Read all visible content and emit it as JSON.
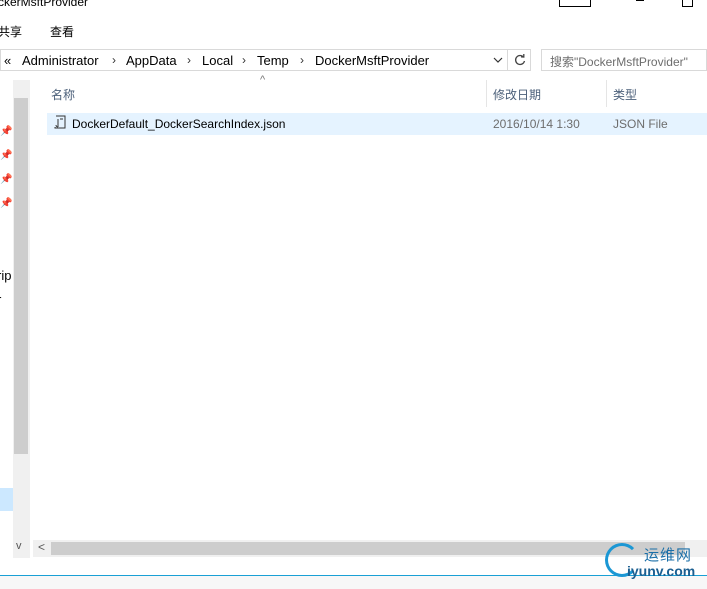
{
  "window": {
    "title": "ckerMsftProvider"
  },
  "ribbon": {
    "tabs": [
      "共享",
      "查看"
    ]
  },
  "address": {
    "overflow": "«",
    "crumbs": [
      "Administrator",
      "AppData",
      "Local",
      "Temp",
      "DockerMsftProvider"
    ],
    "separator": "›",
    "dropdown_icon": "chevron-down-icon",
    "refresh_icon": "refresh-icon"
  },
  "search": {
    "placeholder": "搜索\"DockerMsftProvider\""
  },
  "nav": {
    "fragments": [
      "rip",
      "r"
    ],
    "up_arrow": "^",
    "down_arrow": "v"
  },
  "columns": {
    "name": "名称",
    "date": "修改日期",
    "type": "类型",
    "sort_indicator": "^"
  },
  "files": [
    {
      "name": "DockerDefault_DockerSearchIndex.json",
      "modified": "2016/10/14 1:30",
      "type": "JSON File",
      "icon": "json-file-icon"
    }
  ],
  "hscroll": {
    "left_arrow": "<"
  },
  "watermark": {
    "cn": "运维网",
    "en": "iyunv.com"
  },
  "colors": {
    "selection": "#e5f3ff",
    "accent": "#1b97d4",
    "header_text": "#4c607a"
  }
}
